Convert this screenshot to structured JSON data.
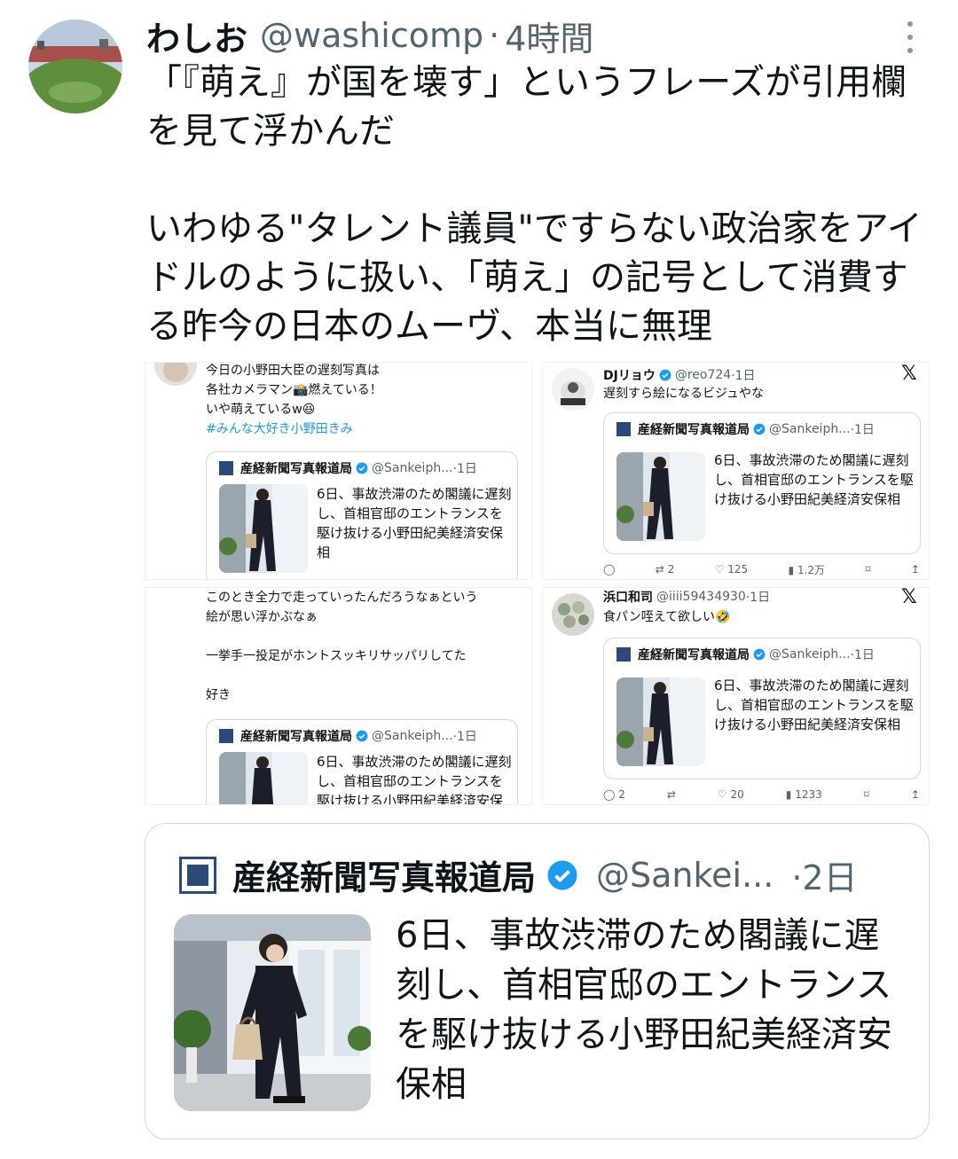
{
  "tweet": {
    "display_name": "わしお",
    "handle": "@washicomp",
    "separator": "·",
    "time": "4時間",
    "text": "「『萌え』が国を壊す」というフレーズが引用欄を見て浮かんだ\n\nいわゆる\"タレント議員\"ですらない政治家をアイドルのように扱い、「萌え」の記号として消費する昨今の日本のムーヴ、本当に無理"
  },
  "collage": {
    "cell1": {
      "text_lines": [
        "今日の小野田大臣の遅刻写真は",
        "各社カメラマン📸燃えている！",
        "いや萌えているw😆"
      ],
      "hashtag": "#みんな大好き小野田きみ"
    },
    "cell2": {
      "name": "DJリョウ",
      "handle": "@reo724",
      "time": "·1日",
      "text": "遅刻すら絵になるビジュやな",
      "metrics": {
        "replies": "",
        "retweets": "2",
        "likes": "125",
        "views": "1.2万"
      }
    },
    "cell3": {
      "text_lines": [
        "このとき全力で走っていったんだろうなぁという",
        "絵が思い浮かぶなぁ",
        "",
        "一挙手一投足がホントスッキリサッパリしてた",
        "",
        "好き"
      ]
    },
    "cell4": {
      "name": "浜口和司",
      "handle": "@iiii59434930",
      "time": "·1日",
      "text": "食パン咥えて欲しい🤣",
      "metrics": {
        "replies": "2",
        "retweets": "",
        "likes": "20",
        "views": "1233"
      }
    },
    "quote": {
      "name": "産経新聞写真報道局",
      "handle": "@Sankeiph...",
      "time": "·1日",
      "text": "6日、事故渋滞のため閣議に遅刻し、首相官邸のエントランスを駆け抜ける小野田紀美経済安保相"
    },
    "x_logo": "𝕏"
  },
  "quoted_tweet": {
    "name": "産経新聞写真報道局",
    "handle": "@Sankei...",
    "time": "·2日",
    "text": "6日、事故渋滞のため閣議に遅刻し、首相官邸のエントランスを駆け抜ける小野田紀美経済安保相"
  },
  "colors": {
    "text": "#0f1419",
    "secondary": "#536471",
    "verified": "#1d9bf0",
    "border": "#cfd9de"
  }
}
